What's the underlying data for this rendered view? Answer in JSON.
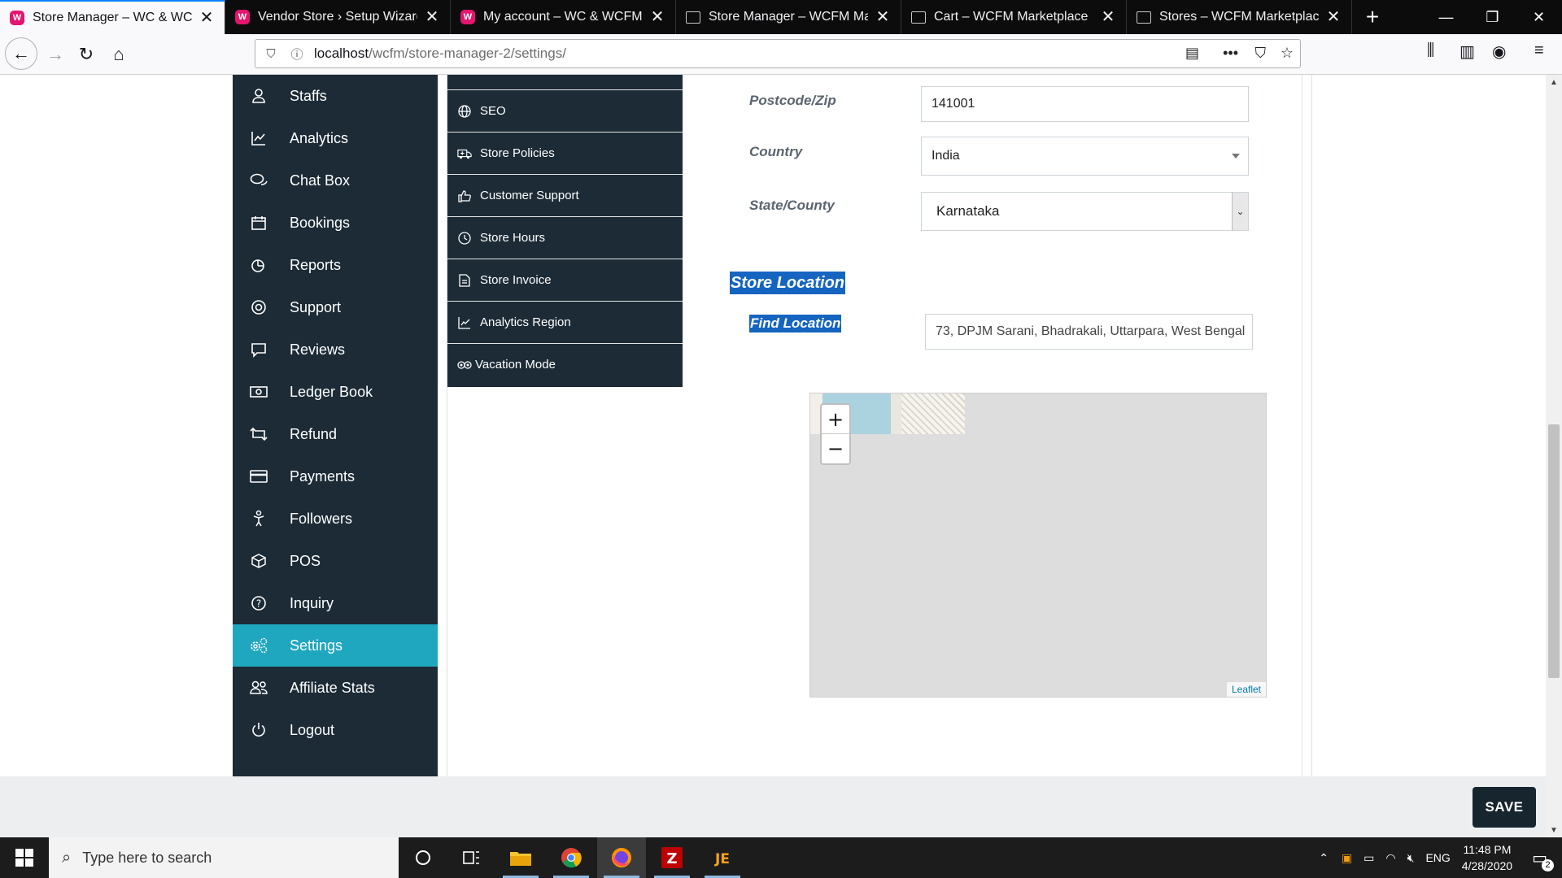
{
  "browser": {
    "tabs": [
      {
        "title": "Store Manager – WC & WCFM",
        "favicon": "wcfm-icon",
        "active": true
      },
      {
        "title": "Vendor Store › Setup Wizard",
        "favicon": "wcfm-icon",
        "active": false
      },
      {
        "title": "My account – WC & WCFM",
        "favicon": "wcfm-icon",
        "active": false
      },
      {
        "title": "Store Manager – WCFM Marke",
        "favicon": "page-icon",
        "active": false
      },
      {
        "title": "Cart – WCFM Marketplace",
        "favicon": "page-icon",
        "active": false
      },
      {
        "title": "Stores – WCFM Marketplace",
        "favicon": "page-icon",
        "active": false
      }
    ],
    "url_host": "localhost",
    "url_path": "/wcfm/store-manager-2/settings/"
  },
  "sidebar": {
    "items": [
      {
        "label": "Staffs",
        "icon": "user-icon"
      },
      {
        "label": "Analytics",
        "icon": "chart-line-icon"
      },
      {
        "label": "Chat Box",
        "icon": "chat-icon"
      },
      {
        "label": "Bookings",
        "icon": "calendar-icon"
      },
      {
        "label": "Reports",
        "icon": "pie-chart-icon"
      },
      {
        "label": "Support",
        "icon": "lifebuoy-icon"
      },
      {
        "label": "Reviews",
        "icon": "comment-icon"
      },
      {
        "label": "Ledger Book",
        "icon": "money-icon"
      },
      {
        "label": "Refund",
        "icon": "retweet-icon"
      },
      {
        "label": "Payments",
        "icon": "credit-card-icon"
      },
      {
        "label": "Followers",
        "icon": "child-icon"
      },
      {
        "label": "POS",
        "icon": "cube-icon"
      },
      {
        "label": "Inquiry",
        "icon": "question-icon"
      },
      {
        "label": "Settings",
        "icon": "cogs-icon",
        "active": true
      },
      {
        "label": "Affiliate Stats",
        "icon": "users-icon"
      },
      {
        "label": "Logout",
        "icon": "power-icon"
      }
    ]
  },
  "settings_menu": {
    "items": [
      {
        "label": "SEO",
        "icon": "globe-icon"
      },
      {
        "label": "Store Policies",
        "icon": "ambulance-icon"
      },
      {
        "label": "Customer Support",
        "icon": "thumbs-up-icon"
      },
      {
        "label": "Store Hours",
        "icon": "clock-icon"
      },
      {
        "label": "Store Invoice",
        "icon": "file-icon"
      },
      {
        "label": "Analytics Region",
        "icon": "chart-line-icon"
      },
      {
        "label": "Vacation Mode",
        "icon": "tripadvisor-icon"
      }
    ]
  },
  "form": {
    "postcode_label": "Postcode/Zip",
    "postcode_value": "141001",
    "country_label": "Country",
    "country_value": "India",
    "state_label": "State/County",
    "state_value": "Karnataka",
    "store_location_heading": "Store Location",
    "find_location_label": "Find Location",
    "find_location_value": "73, DPJM Sarani, Bhadrakali, Uttarpara, West Bengal"
  },
  "map": {
    "zoom_in": "+",
    "zoom_out": "−",
    "attribution": "Leaflet"
  },
  "actions": {
    "save_label": "SAVE"
  },
  "taskbar": {
    "search_placeholder": "Type here to search",
    "language": "ENG",
    "time": "11:48 PM",
    "date": "4/28/2020",
    "notification_count": "2"
  },
  "colors": {
    "sidebar_bg": "#1c2b36",
    "active_item": "#20a7c0",
    "highlight": "#1565c0",
    "save_button": "#17252f"
  }
}
